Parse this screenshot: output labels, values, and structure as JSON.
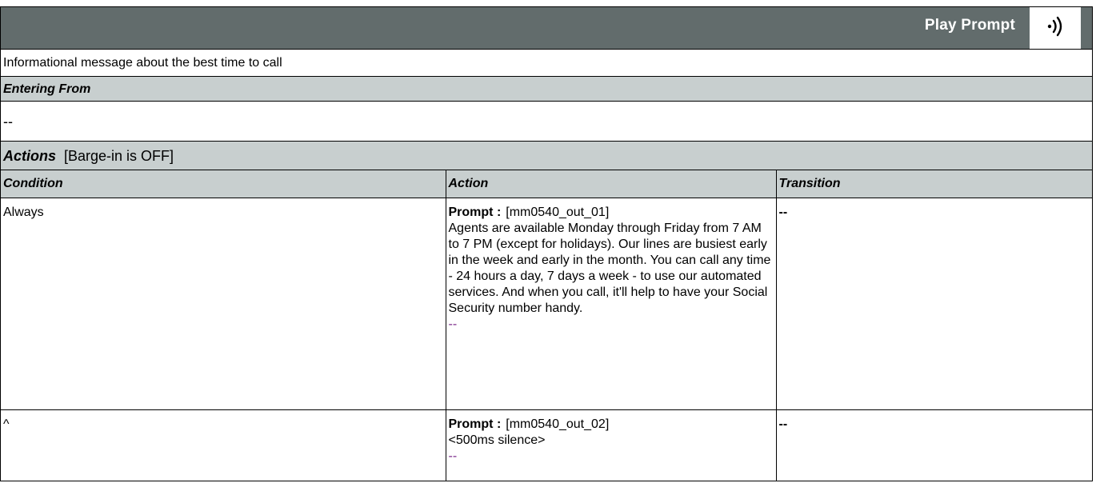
{
  "header": {
    "title": "Play Prompt",
    "icon": "speaker-icon"
  },
  "description": "Informational message about the best time to call",
  "entering_from": {
    "label": "Entering From",
    "value": "--"
  },
  "actions": {
    "title": "Actions",
    "barge_in": "[Barge-in is OFF]",
    "columns": [
      "Condition",
      "Action",
      "Transition"
    ],
    "rows": [
      {
        "condition": "Always",
        "prompt_label": "Prompt :",
        "prompt_code": "[mm0540_out_01]",
        "prompt_text": "Agents are available Monday through Friday from 7 AM to 7 PM (except for holidays). Our lines are busiest early in the week and early in the month. You can call any time - 24 hours a day, 7 days a week - to use our automated services.  And when you call, it'll help to have your Social Security number handy.",
        "prompt_suffix": "--",
        "transition": "--"
      },
      {
        "condition": "^",
        "prompt_label": "Prompt :",
        "prompt_code": "[mm0540_out_02]",
        "prompt_text": "<500ms silence>",
        "prompt_suffix": "--",
        "transition": "--"
      }
    ]
  }
}
